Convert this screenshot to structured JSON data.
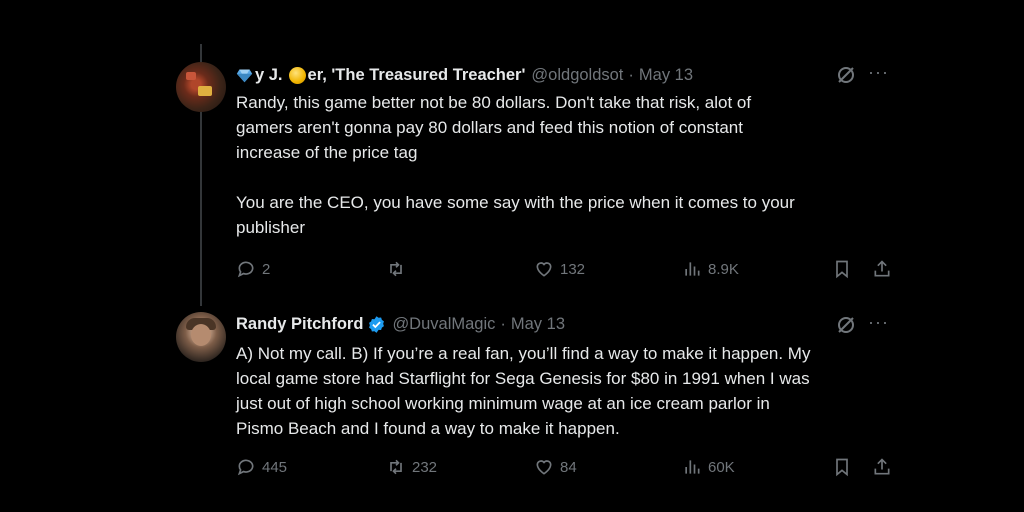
{
  "tweet1": {
    "name_prefix": "y J.",
    "name_suffix": "er, 'The Treasured Treacher'",
    "handle": "@oldgoldsot",
    "date": "May 13",
    "para1_lines": [
      "Randy, this game better not be 80 dollars. Don't take that risk, alot of",
      "gamers aren't gonna pay 80 dollars and feed this notion of constant",
      "increase of the price tag"
    ],
    "para2_lines": [
      "You are the CEO, you have some say with the price when it comes to your",
      "publisher"
    ],
    "replies": "2",
    "retweets": "",
    "likes": "132",
    "views": "8.9K"
  },
  "tweet2": {
    "name": "Randy Pitchford",
    "handle": "@DuvalMagic",
    "date": "May 13",
    "lines": [
      "A) Not my call. B) If you’re a real fan, you’ll find a way to make it happen. My",
      "local game store had Starflight for Sega Genesis for $80 in 1991 when I was",
      "just out of high school working minimum wage at an ice cream parlor in",
      "Pismo Beach and I found a way to make it happen."
    ],
    "replies": "445",
    "retweets": "232",
    "likes": "84",
    "views": "60K"
  },
  "common": {
    "dot": "·",
    "more": "···"
  },
  "colors": {
    "background": "#000000",
    "text": "#e7e9ea",
    "muted": "#71767b",
    "verified": "#1d9bf0",
    "thread_line": "#333639"
  }
}
